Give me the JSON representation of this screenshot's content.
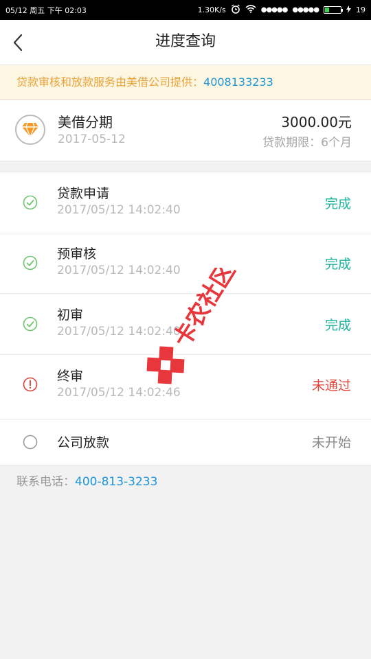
{
  "status_bar": {
    "date": "05/12",
    "weekday": "周五",
    "time": "下午 02:03",
    "net_speed": "1.30K/s",
    "signal_a": "●●●●●",
    "signal_b": "●●●●●",
    "battery_level": "19"
  },
  "header": {
    "title": "进度查询"
  },
  "notice": {
    "text": "贷款审核和放款服务由美借公司提供：",
    "phone": "4008133233"
  },
  "loan": {
    "name": "美借分期",
    "date": "2017-05-12",
    "amount": "3000.00元",
    "term": "贷款期限：6个月"
  },
  "steps": [
    {
      "name": "贷款申请",
      "time": "2017/05/12 14:02:40",
      "status": "完成",
      "state": "done"
    },
    {
      "name": "预审核",
      "time": "2017/05/12 14:02:40",
      "status": "完成",
      "state": "done"
    },
    {
      "name": "初审",
      "time": "2017/05/12 14:02:40",
      "status": "完成",
      "state": "done"
    },
    {
      "name": "终审",
      "time": "2017/05/12 14:02:46",
      "status": "未通过",
      "state": "fail"
    },
    {
      "name": "公司放款",
      "time": "",
      "status": "未开始",
      "state": "pending"
    }
  ],
  "contact": {
    "label": "联系电话：",
    "phone": "400-813-3233"
  },
  "watermark": {
    "text": "卡农社区"
  },
  "colors": {
    "done": "#1fb29a",
    "fail": "#e0463c",
    "pending": "#888888",
    "link": "#1d95d6",
    "notice_text": "#e8a43a"
  },
  "icons": {
    "back": "chevron-left-icon",
    "product": "diamond-icon",
    "done": "check-circle-icon",
    "fail": "exclamation-circle-icon",
    "pending": "empty-circle-icon"
  }
}
